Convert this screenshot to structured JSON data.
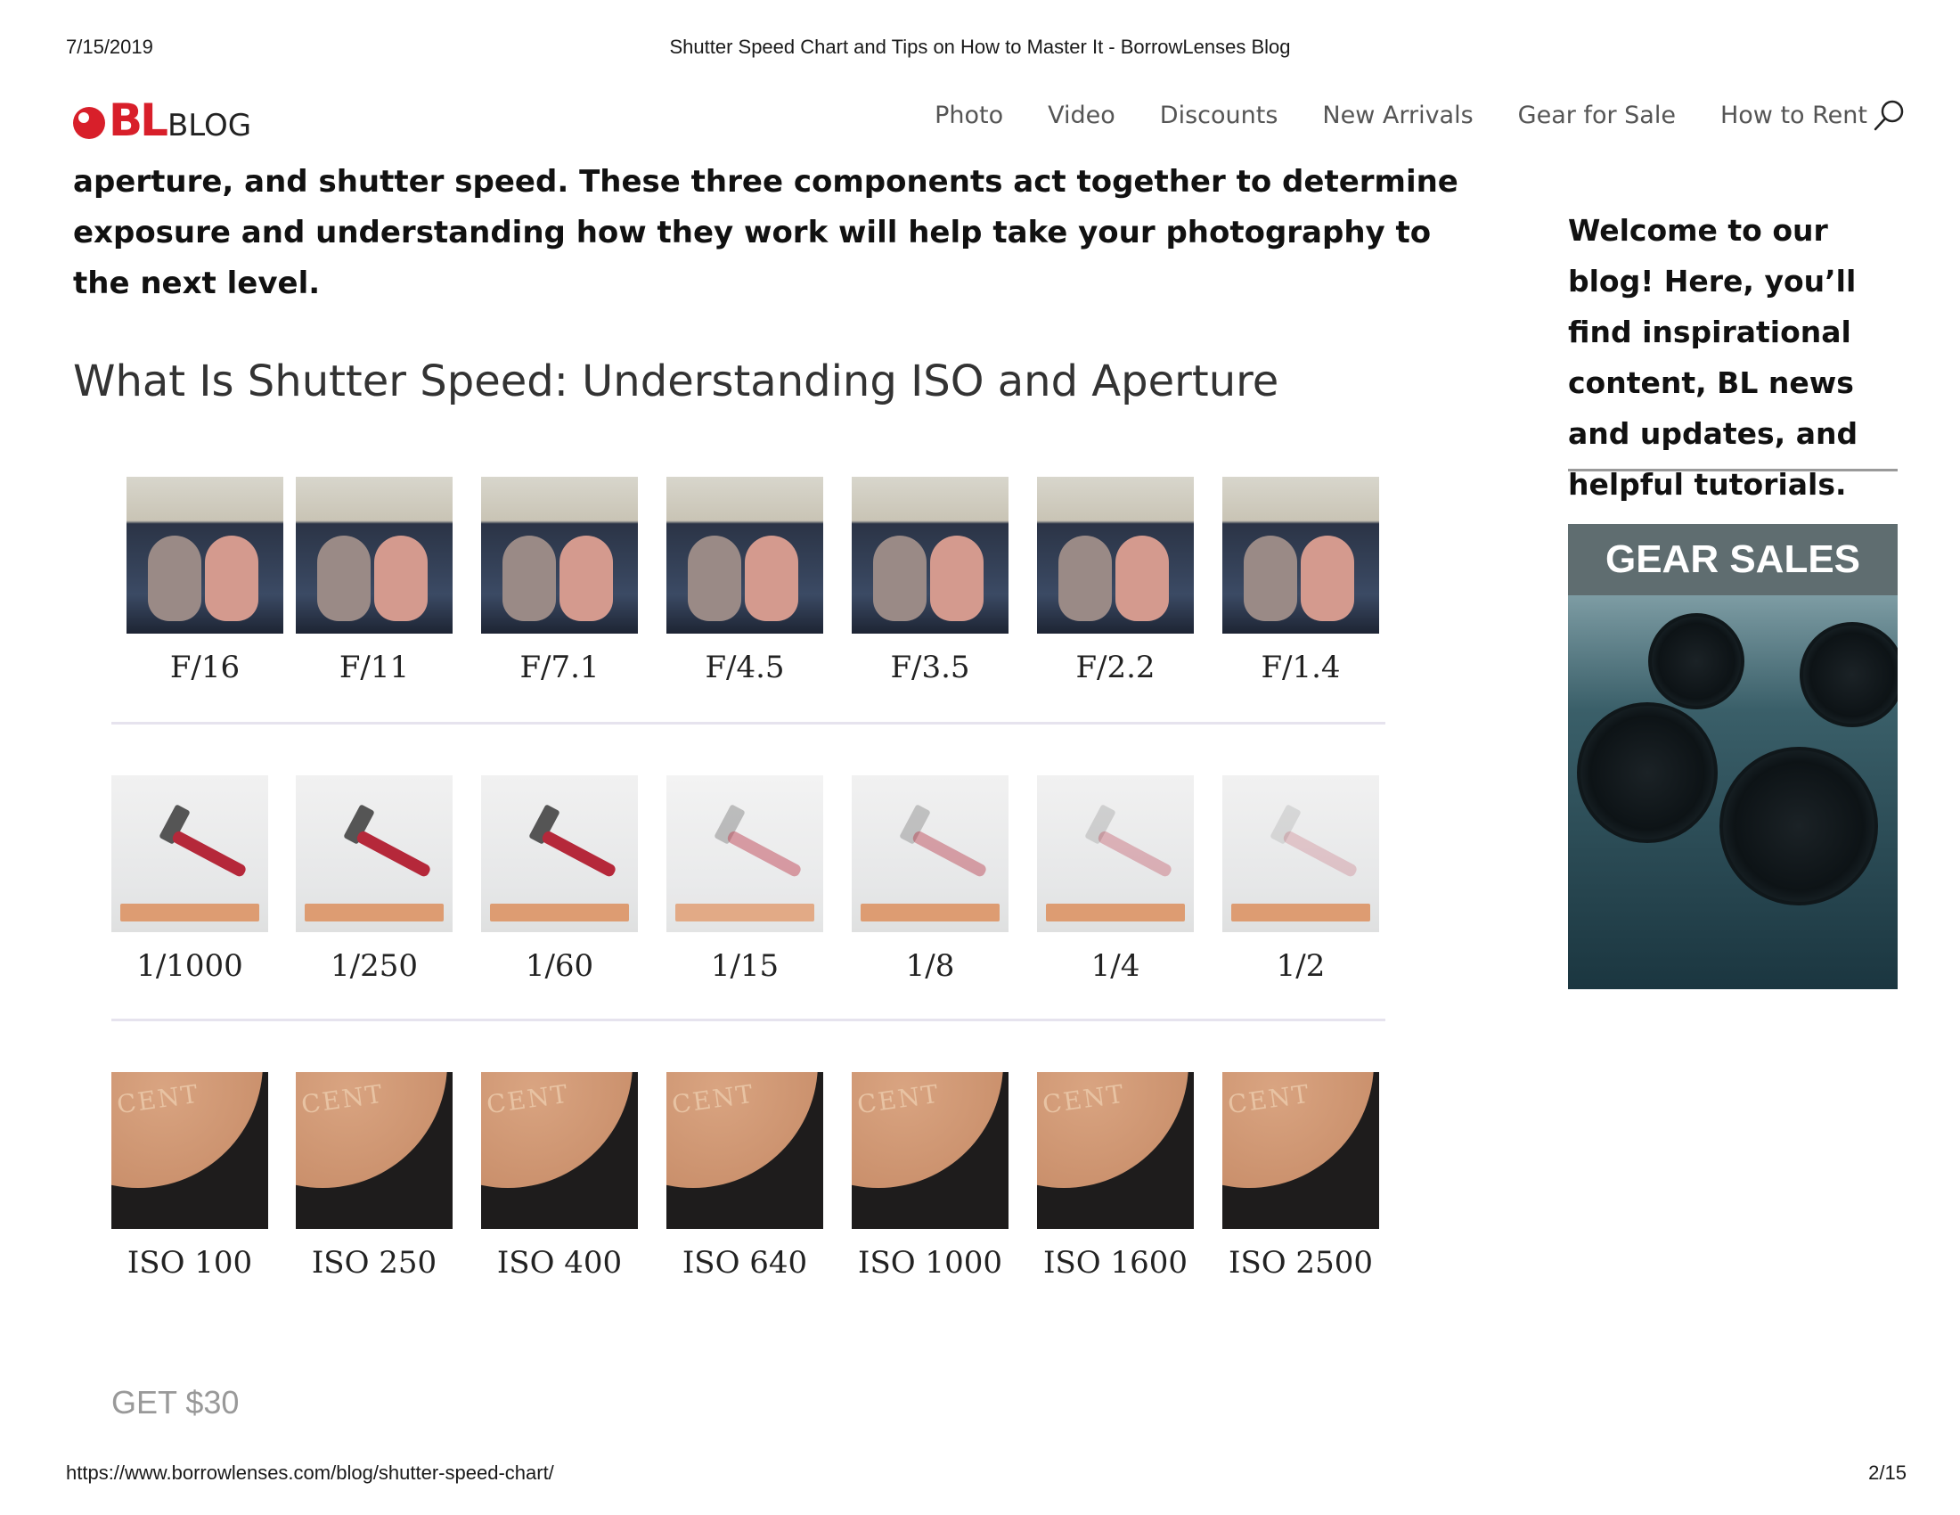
{
  "print_header": {
    "date": "7/15/2019",
    "title": "Shutter Speed Chart and Tips on How to Master It - BorrowLenses Blog"
  },
  "print_footer": {
    "url": "https://www.borrowlenses.com/blog/shutter-speed-chart/",
    "page": "2/15"
  },
  "header": {
    "logo_mark": "BL",
    "logo_text": "BLOG",
    "nav": [
      "Photo",
      "Video",
      "Discounts",
      "New Arrivals",
      "Gear for Sale",
      "How to Rent"
    ],
    "search_icon": "search-icon"
  },
  "article": {
    "intro": "aperture, and shutter speed. These three components act together to determine exposure and understanding how they work will help take your photography to the next level.",
    "heading": "What Is Shutter Speed: Understanding ISO and Aperture",
    "chart": {
      "apertures": [
        "F/16",
        "F/11",
        "F/7.1",
        "F/4.5",
        "F/3.5",
        "F/2.2",
        "F/1.4"
      ],
      "shutter_speeds": [
        "1/1000",
        "1/250",
        "1/60",
        "1/15",
        "1/8",
        "1/4",
        "1/2"
      ],
      "isos": [
        "ISO 100",
        "ISO 250",
        "ISO 400",
        "ISO 640",
        "ISO 1000",
        "ISO 1600",
        "ISO 2500"
      ],
      "coin_text": "CENT"
    },
    "promo": "GET $30"
  },
  "sidebar": {
    "welcome": "Welcome to our blog! Here, you’ll find inspirational content, BL news and updates, and helpful tutorials.",
    "ad_title": "GEAR SALES"
  }
}
